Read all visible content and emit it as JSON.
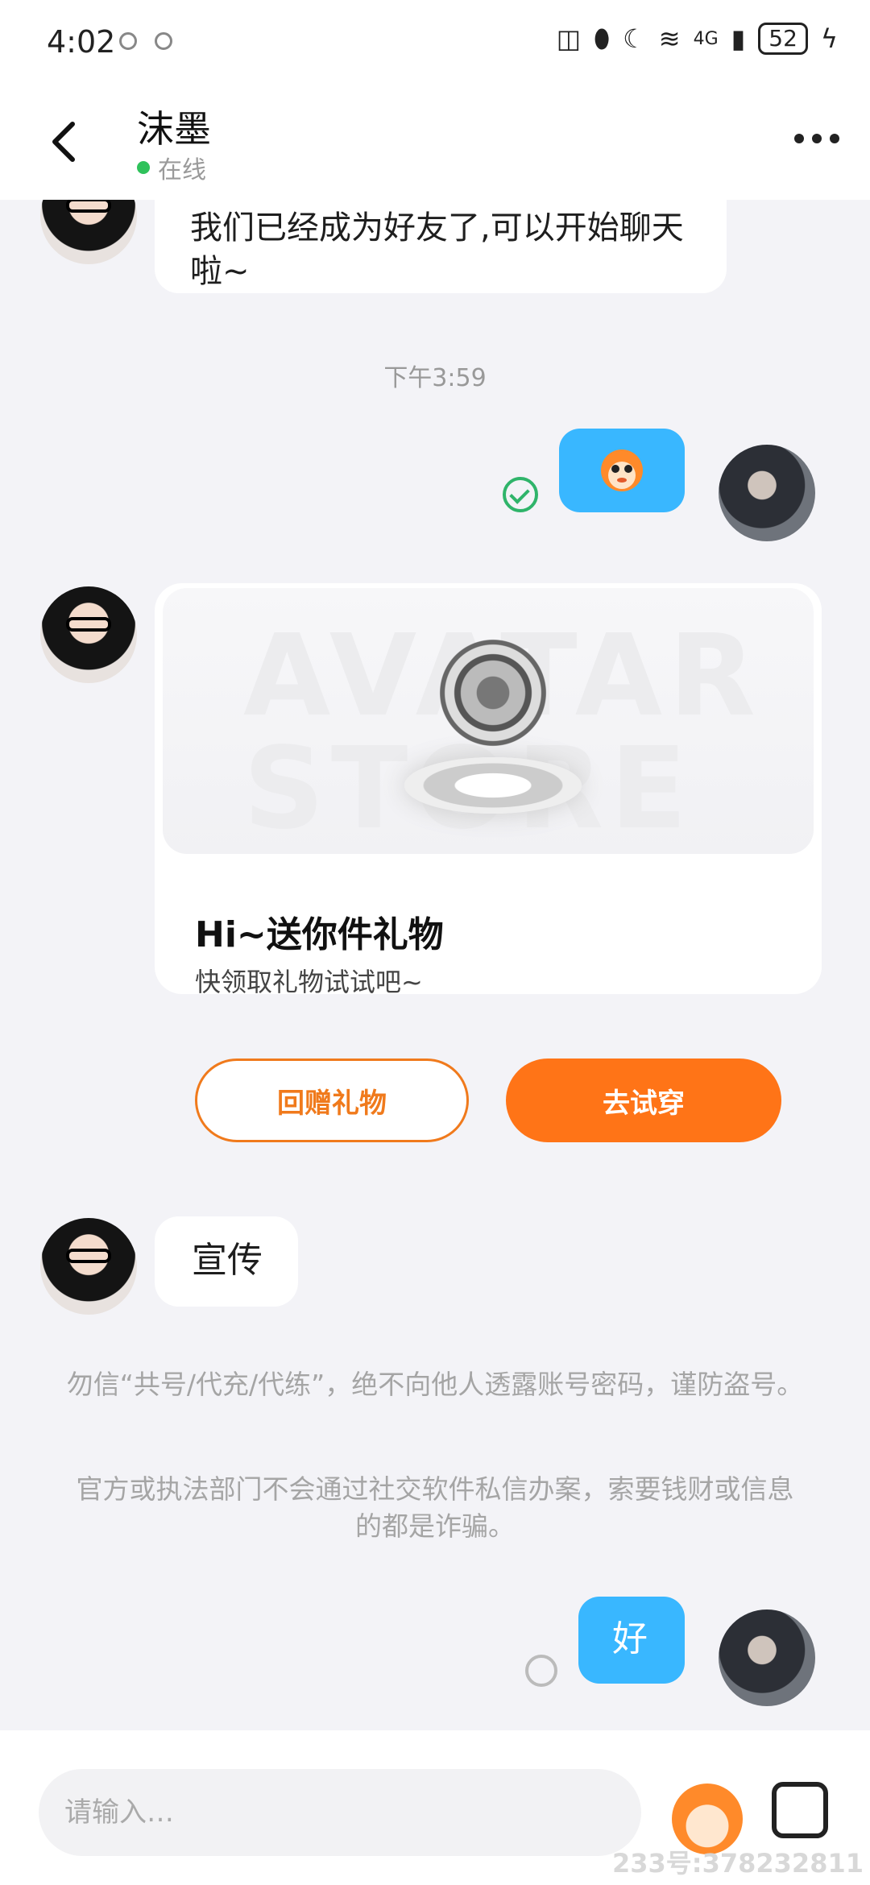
{
  "status_bar": {
    "time": "4:02",
    "network": "4G",
    "battery": "52"
  },
  "header": {
    "contact_name": "沫墨",
    "status": "在线"
  },
  "messages": {
    "first_text": "我们已经成为好友了,可以开始聊天啦~",
    "timestamp": "下午3:59",
    "reply_text": "宣传",
    "last_text": "好"
  },
  "gift_card": {
    "watermark": "AVATAR STORE",
    "title": "Hi~送你件礼物",
    "subtitle": "快领取礼物试试吧~",
    "return_gift_label": "回赠礼物",
    "try_on_label": "去试穿"
  },
  "notices": {
    "line1": "勿信“共号/代充/代练”，绝不向他人透露账号密码，谨防盗号。",
    "line2": "官方或执法部门不会通过社交软件私信办案，索要钱财或信息的都是诈骗。"
  },
  "input": {
    "placeholder": "请输入…"
  },
  "watermark": "233号:378232811",
  "colors": {
    "accent_orange": "#ff7417",
    "bubble_blue": "#39b7ff",
    "online_green": "#2fc25b"
  },
  "icons": [
    "back-arrow-icon",
    "more-icon",
    "read-check-icon",
    "pending-circle-icon",
    "emoji-icon",
    "image-icon"
  ]
}
